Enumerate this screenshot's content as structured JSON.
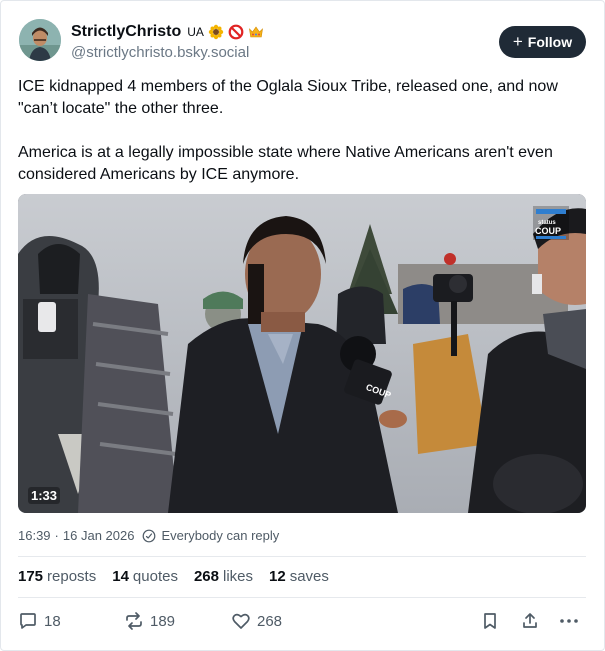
{
  "author": {
    "display_name": "StrictlyChristo",
    "name_tag": "UA",
    "badges": [
      "sunflower-emoji",
      "prohibited-emoji",
      "crown-emoji"
    ],
    "handle": "@strictlychristo.bsky.social"
  },
  "follow_label": "Follow",
  "post": {
    "paragraphs": [
      "ICE kidnapped 4 members of the Oglala Sioux Tribe, released one, and now \"can’t locate\" the other three.",
      "America is at a legally impossible state where Native Americans aren't even considered Americans by ICE anymore."
    ]
  },
  "video": {
    "duration": "1:33",
    "watermark_top": "THE COUP",
    "watermark_small": "status"
  },
  "meta": {
    "time": "16:39",
    "separator": "·",
    "date": "16 Jan 2026",
    "reply_setting": "Everybody can reply"
  },
  "stats": {
    "reposts_count": "175",
    "reposts_label": "reposts",
    "quotes_count": "14",
    "quotes_label": "quotes",
    "likes_count": "268",
    "likes_label": "likes",
    "saves_count": "12",
    "saves_label": "saves"
  },
  "actions": {
    "reply_count": "18",
    "repost_count": "189",
    "like_count": "268"
  },
  "colors": {
    "follow_bg": "#1f2a36",
    "secondary_text": "#4f5b66",
    "divider": "#e6e9ed"
  }
}
